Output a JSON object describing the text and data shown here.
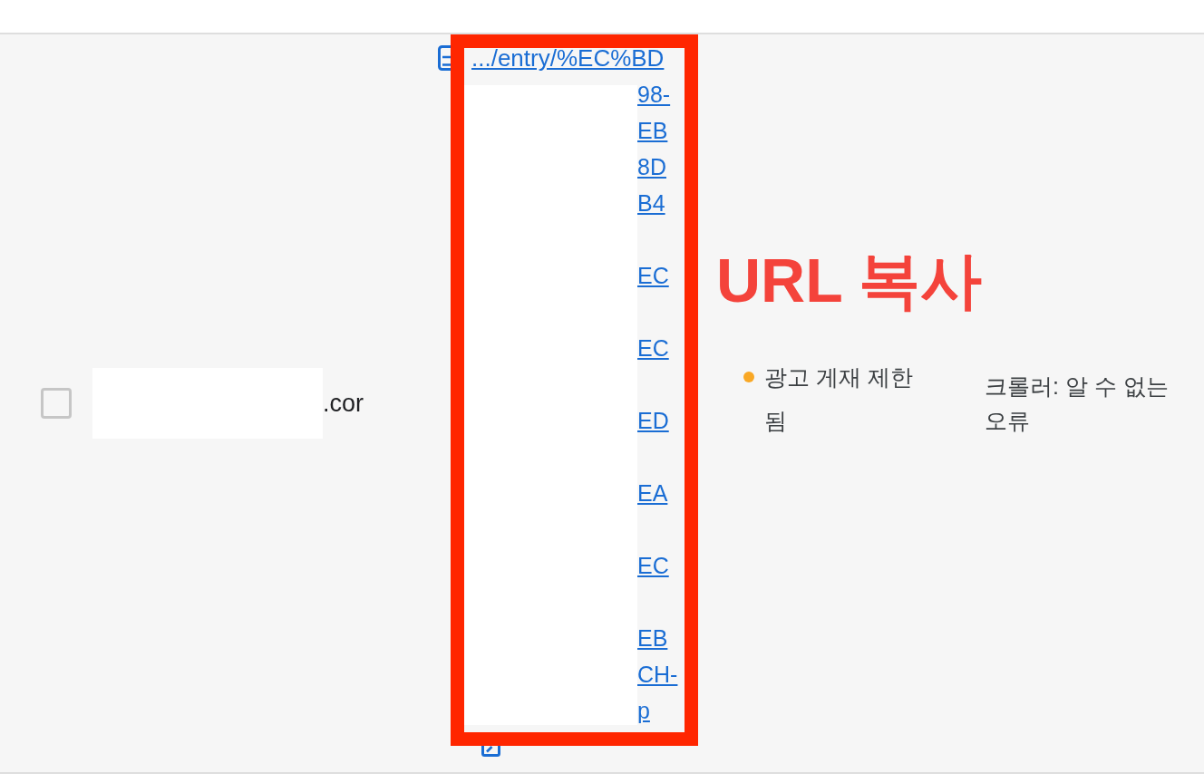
{
  "row": {
    "checkbox": {
      "checked": false
    },
    "domain": ".cor",
    "url_link": {
      "first_line": ".../entry/%EC%BD",
      "visible_fragments": [
        "98-",
        "EB",
        "8D",
        "B4",
        "EC",
        "EC",
        "ED",
        "EA",
        "EC",
        "EB",
        "CH-",
        "p"
      ]
    },
    "status": {
      "label": "광고 게재 제한 됨"
    },
    "error": "크롤러: 알 수 없는 오류"
  },
  "annotation": {
    "label": "URL 복사"
  }
}
